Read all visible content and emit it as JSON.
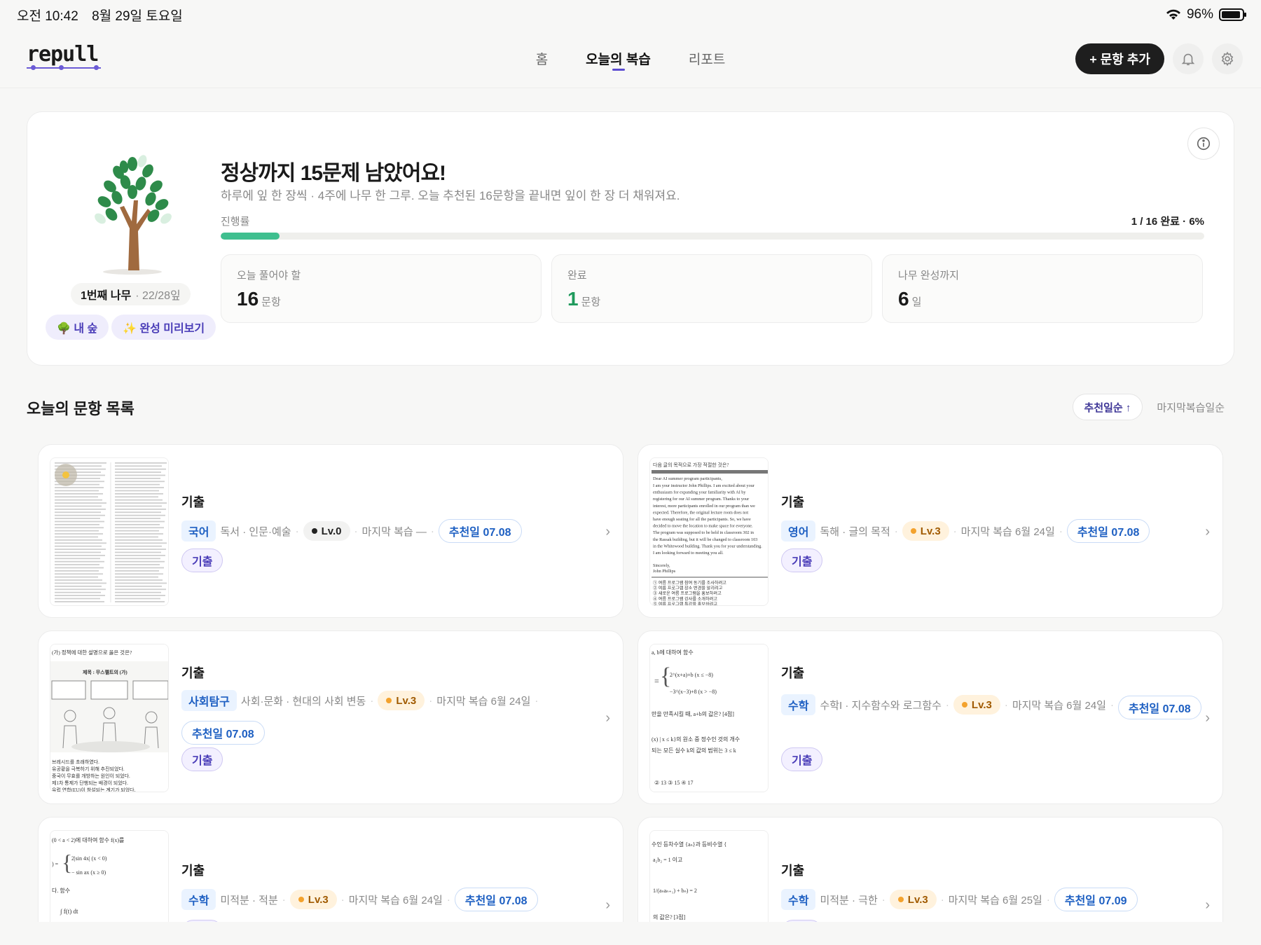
{
  "status": {
    "time": "오전 10:42",
    "date": "8월 29일 토요일",
    "battery": "96%"
  },
  "nav": {
    "logo": "repull",
    "tabs": [
      {
        "label": "홈"
      },
      {
        "label": "오늘의 복습"
      },
      {
        "label": "리포트"
      }
    ],
    "add_button": "+ 문항 추가"
  },
  "hero": {
    "title": "정상까지 15문제 남았어요!",
    "subtitle": "하루에 잎 한 장씩 · 4주에 나무 한 그루. 오늘 추천된 16문항을 끝내면 잎이 한 장 더 채워져요.",
    "progress_label": "진행률",
    "progress_text": "1 / 16 완료 · 6%",
    "progress_percent": 6,
    "tree_name": "1번째 나무",
    "tree_sub": "· 22/28잎",
    "forest_chip": "🌳 내 숲",
    "preview_chip": "✨ 완성 미리보기",
    "stats": [
      {
        "label": "오늘 풀어야 할",
        "value": "16",
        "unit": "문항",
        "color": "#1a1a1a"
      },
      {
        "label": "완료",
        "value": "1",
        "unit": "문항",
        "color": "#1f9a5c"
      },
      {
        "label": "나무 완성까지",
        "value": "6",
        "unit": "일",
        "color": "#1a1a1a"
      }
    ]
  },
  "list": {
    "title": "오늘의 문항 목록",
    "sort": [
      {
        "label": "추천일순 ↑"
      },
      {
        "label": "마지막복습일순"
      }
    ],
    "cards": [
      {
        "kind": "기출",
        "subject": "국어",
        "topic": "독서 · 인문·예술",
        "level": "Lv.0",
        "last": "마지막 복습 —",
        "date": "추천일 07.08",
        "tag": "기출"
      },
      {
        "kind": "기출",
        "subject": "영어",
        "topic": "독해 · 글의 목적",
        "level": "Lv.3",
        "last": "마지막 복습 6월 24일",
        "date": "추천일 07.08",
        "tag": "기출"
      },
      {
        "kind": "기출",
        "subject": "사회탐구",
        "topic": "사회·문화 · 현대의 사회 변동",
        "level": "Lv.3",
        "last": "마지막 복습 6월 24일",
        "date": "추천일 07.08",
        "tag": "기출"
      },
      {
        "kind": "기출",
        "subject": "수학",
        "topic": "수학I · 지수함수와 로그함수",
        "level": "Lv.3",
        "last": "마지막 복습 6월 24일",
        "date": "추천일 07.08",
        "tag": "기출"
      },
      {
        "kind": "기출",
        "subject": "수학",
        "topic": "미적분 · 적분",
        "level": "Lv.3",
        "last": "마지막 복습 6월 24일",
        "date": "추천일 07.08",
        "tag": "기출"
      },
      {
        "kind": "기출",
        "subject": "수학",
        "topic": "미적분 · 극한",
        "level": "Lv.3",
        "last": "마지막 복습 6월 25일",
        "date": "추천일 07.09",
        "tag": "기출"
      }
    ]
  },
  "thumbs": {
    "english": {
      "head": "다음 글의 목적으로 가장 적절한 것은?",
      "greet": "Dear AI summer program participants,",
      "lines": [
        "I am your instructor John Phillips. I am excited about your",
        "enthusiasm for expanding your familiarity with AI by",
        "registering for our AI summer program. Thanks to your",
        "interest, more participants enrolled in our program than we",
        "expected. Therefore, the original lecture room does not",
        "have enough seating for all the participants. So, we have",
        "decided to move the location to make space for everyone.",
        "The program was supposed to be held in classroom 302 in",
        "the Rassak building, but it will be changed to classroom 103",
        "in the Whitewood building. Thank you for your understanding.",
        "I am looking forward to meeting you all."
      ],
      "sign": "Sincerely,\nJohn Phillips",
      "choices": [
        "① 여름 프로그램 참여 동기를 조사하려고",
        "② 여름 프로그램 장소 변경을 알리려고",
        "③ 새로운 여름 프로그램을 홍보하려고",
        "④ 여름 프로그램 강사를 소개하려고",
        "⑤ 여름 프로그램 특강을 홍보하려고"
      ]
    },
    "social": {
      "head": "(가) 정책에 대한 설명으로 옳은 것은?",
      "title": "제목 : 무스펠트의 (가)",
      "foot": [
        "브레시드를 초래하였다.",
        "유공황을 극복하기 위해 추진되었다.",
        "중국이 무효를 개방하는 원인이 되었다.",
        "제1차 통제가 단행되는 배경이 되었다.",
        "유럽 연합(EU)이 창설되는 계기가 되었다."
      ]
    },
    "math1": {
      "lines": [
        "a, b에 대하여 함수",
        "2^(x+a)+b  (x ≤ −8)",
        "−3^(x−3)+8  (x > −8)",
        "만을 만족시킬 때, a+b의 값은? [4점]",
        "(x) | x ≤ k}의 원소 중 정수인 것의 개수",
        "되는 모든 실수 k의 값의 범위는 3 ≤ k",
        "② 13   ③ 15   ④ 17"
      ]
    },
    "math2": {
      "lines": [
        "(0 < a < 2)에 대하여 함수 f(x)를",
        "2|sin 4x|   (x < 0)",
        "− sin ax     (x ≥ 0)",
        "다. 함수",
        "∫ f(t) dt"
      ]
    },
    "math3": {
      "lines": [
        "수인 등차수열 {aₙ}과 등비수열 {",
        "a₂b₂ = 1 이고",
        "1/(aₙaₙ₊₁) + bₙ) = 2",
        "의 값은? [3점]"
      ]
    }
  },
  "colors": {
    "accent": "#5b4bd1",
    "progress": "#3fbf8f",
    "subject_bg": "#eaf3ff",
    "subject_text": "#1d5fc2"
  }
}
